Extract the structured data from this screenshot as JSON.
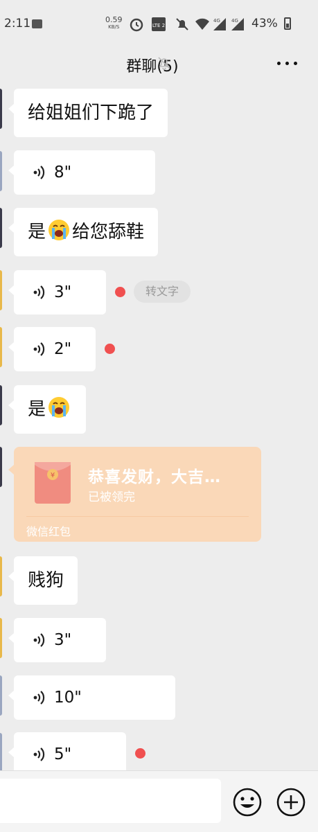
{
  "status_bar": {
    "time": "2:11",
    "net_speed_value": "0.59",
    "net_speed_unit": "KB/S",
    "battery_percent": "43%",
    "signal_labels": [
      "4G",
      "4G"
    ],
    "volte_label": "LTE 2"
  },
  "nav": {
    "title": "群聊(5)",
    "icons": [
      "mute-bell-icon",
      "more-dots-icon"
    ]
  },
  "messages": [
    {
      "type": "text",
      "text": "给姐姐们下跪了"
    },
    {
      "type": "voice",
      "duration": "8\""
    },
    {
      "type": "text",
      "text_before": "是",
      "emoji": "loudly-crying-face",
      "text_after": "给您舔鞋"
    },
    {
      "type": "voice",
      "duration": "3\"",
      "unread": true,
      "to_text_label": "转文字"
    },
    {
      "type": "voice",
      "duration": "2\"",
      "unread": true
    },
    {
      "type": "text",
      "text_before": "是",
      "emoji": "loudly-crying-face"
    },
    {
      "type": "red_packet",
      "greeting": "恭喜发财，大吉…",
      "status": "已被领完",
      "label": "微信红包"
    },
    {
      "type": "text",
      "text": "贱狗"
    },
    {
      "type": "voice",
      "duration": "3\""
    },
    {
      "type": "voice",
      "duration": "10\""
    },
    {
      "type": "voice",
      "duration": "5\"",
      "unread": true
    }
  ],
  "input_bar": {
    "placeholder": "",
    "icons": [
      "emoji-icon",
      "add-icon"
    ]
  },
  "colors": {
    "background": "#ededed",
    "bubble": "#ffffff",
    "red_packet_bg": "#fad8b8",
    "unread_dot": "#f05050"
  }
}
